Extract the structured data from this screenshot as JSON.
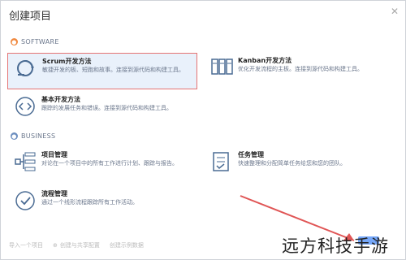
{
  "dialog": {
    "title": "创建项目"
  },
  "sections": {
    "software": "SOFTWARE",
    "business": "BUSINESS"
  },
  "software_cards": [
    {
      "title": "Scrum开发方法",
      "desc": "敏捷开发的板、短跑和故事。连接到源代码和构建工具。"
    },
    {
      "title": "Kanban开发方法",
      "desc": "优化开发流程的主板。连接到源代码和构建工具。"
    },
    {
      "title": "基本开发方法",
      "desc": "跟踪的发展任务和错误。连接到源代码和构建工具。"
    }
  ],
  "business_cards": [
    {
      "title": "项目管理",
      "desc": "对论在一个项目中的所有工作进行计划、跟踪与报告。"
    },
    {
      "title": "任务管理",
      "desc": "快速整理和分配简单任务给您和您的团队。"
    },
    {
      "title": "流程管理",
      "desc": "通过一个线形流程跟踪所有工作活动。"
    }
  ],
  "footer": {
    "import": "导入一个项目",
    "shared": "创建与共享配置",
    "sample": "创建示例数据"
  },
  "watermark": "远方科技手游",
  "colors": {
    "selected_border": "#e57373",
    "accent": "#3b82f6"
  }
}
